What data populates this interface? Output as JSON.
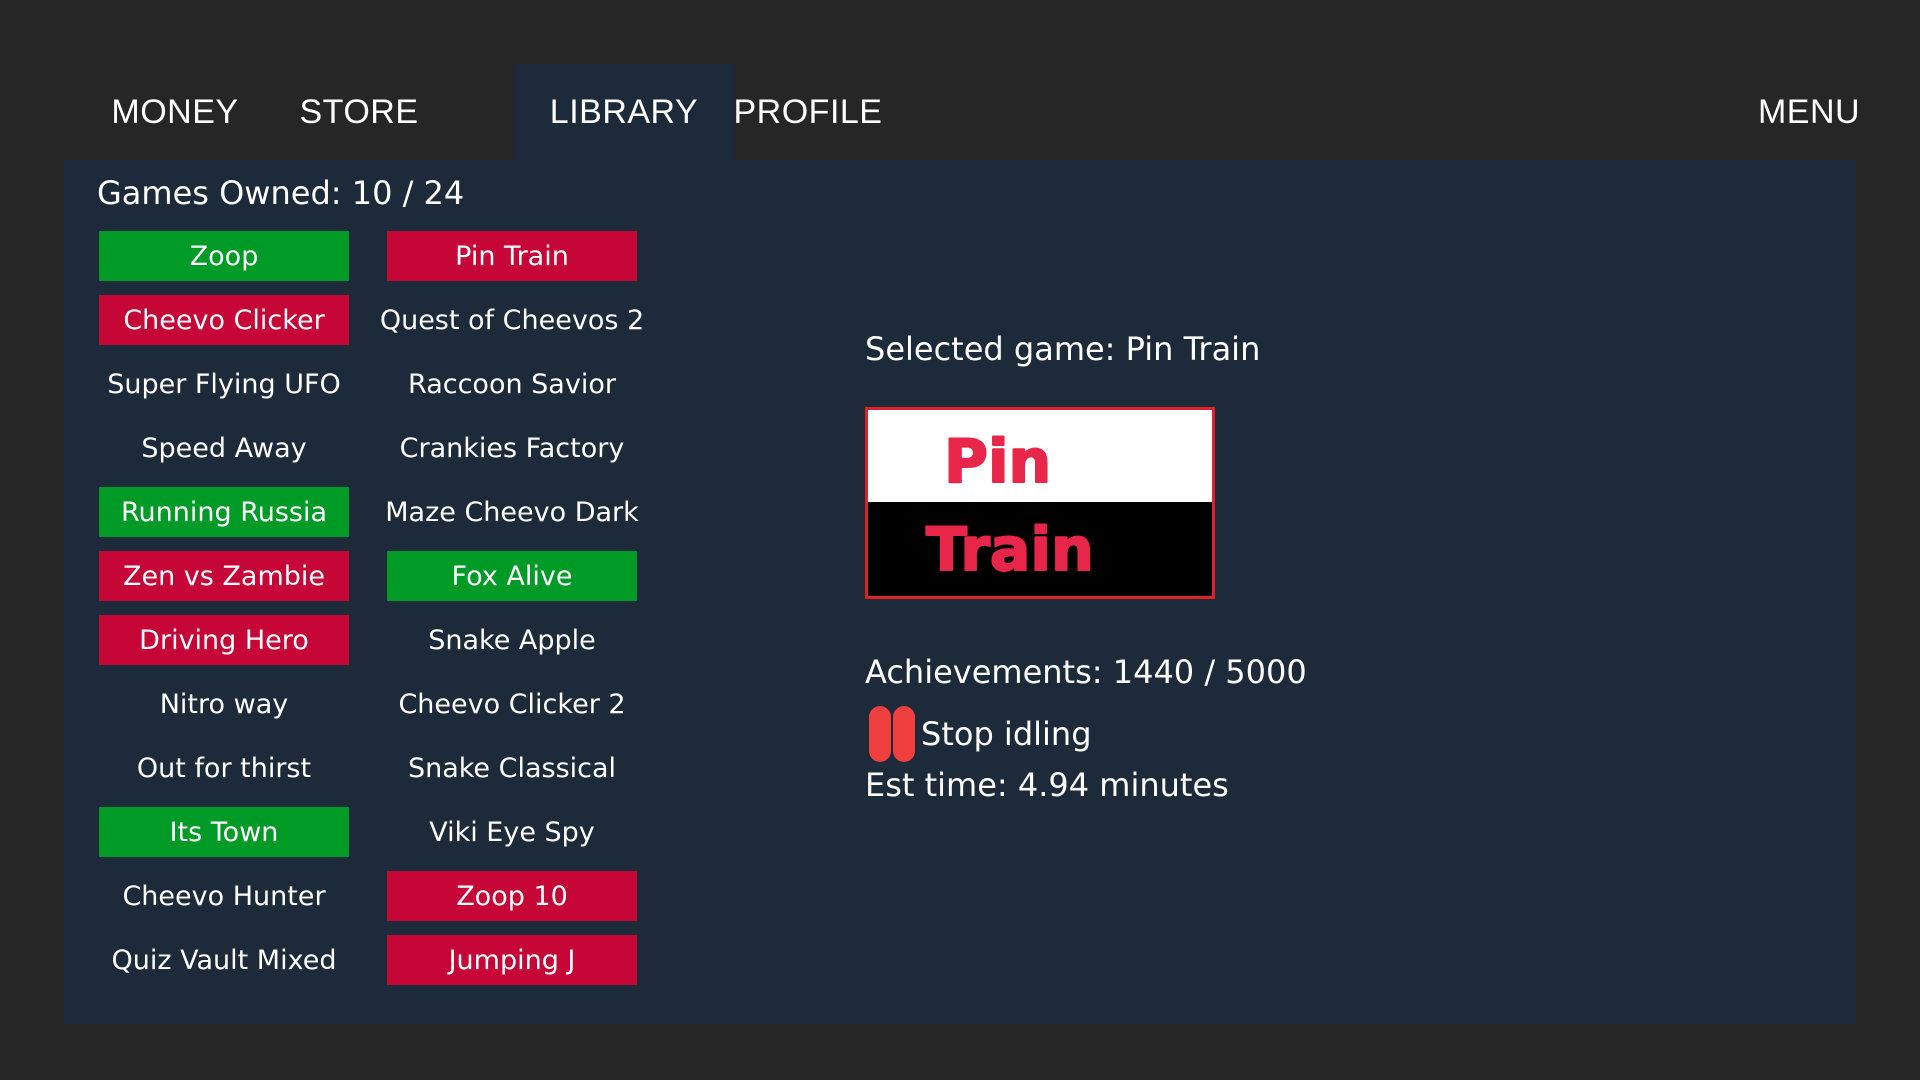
{
  "nav": {
    "tabs": [
      {
        "label": "MONEY",
        "active": false
      },
      {
        "label": "STORE",
        "active": false
      },
      {
        "label": "LIBRARY",
        "active": true
      },
      {
        "label": "PROFILE",
        "active": false
      }
    ],
    "menu_label": "MENU"
  },
  "library": {
    "owned_text": "Games Owned: 10 / 24",
    "games": [
      {
        "name": "Zoop",
        "status": "green"
      },
      {
        "name": "Pin Train",
        "status": "red"
      },
      {
        "name": "Cheevo Clicker",
        "status": "red"
      },
      {
        "name": "Quest of Cheevos 2",
        "status": "none"
      },
      {
        "name": "Super Flying UFO",
        "status": "none"
      },
      {
        "name": "Raccoon Savior",
        "status": "none"
      },
      {
        "name": "Speed Away",
        "status": "none"
      },
      {
        "name": "Crankies Factory",
        "status": "none"
      },
      {
        "name": "Running Russia",
        "status": "green"
      },
      {
        "name": "Maze Cheevo Dark",
        "status": "none"
      },
      {
        "name": "Zen vs Zambie",
        "status": "red"
      },
      {
        "name": "Fox Alive",
        "status": "green"
      },
      {
        "name": "Driving Hero",
        "status": "red"
      },
      {
        "name": "Snake Apple",
        "status": "none"
      },
      {
        "name": "Nitro way",
        "status": "none"
      },
      {
        "name": "Cheevo Clicker 2",
        "status": "none"
      },
      {
        "name": "Out for thirst",
        "status": "none"
      },
      {
        "name": "Snake Classical",
        "status": "none"
      },
      {
        "name": "Its Town",
        "status": "green"
      },
      {
        "name": "Viki Eye Spy",
        "status": "none"
      },
      {
        "name": "Cheevo Hunter",
        "status": "none"
      },
      {
        "name": "Zoop 10",
        "status": "red"
      },
      {
        "name": "Quiz Vault Mixed",
        "status": "none"
      },
      {
        "name": "Jumping J",
        "status": "red"
      }
    ]
  },
  "selected": {
    "label": "Selected game: Pin Train",
    "cover": {
      "line1": "Pin",
      "line2": "Train"
    },
    "achievements": "Achievements: 1440 / 5000",
    "idle_button": "Stop idling",
    "est_time": "Est time: 4.94 minutes"
  },
  "colors": {
    "background": "#262626",
    "panel": "#1c2a3a",
    "green": "#009b27",
    "red": "#c60636",
    "pause_icon": "#ef3f3f",
    "cover_border": "#e0202a",
    "cover_text": "#e8264a"
  },
  "icons": {
    "idle_button": "pause-icon"
  }
}
